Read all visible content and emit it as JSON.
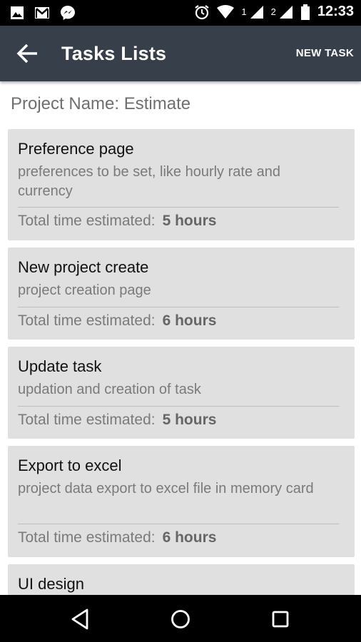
{
  "status_bar": {
    "time": "12:33",
    "sim1": "1",
    "sim2": "2",
    "icons_left": [
      "image-icon",
      "gmail-icon",
      "messenger-icon"
    ],
    "icons_right": [
      "alarm-icon",
      "wifi-icon",
      "signal-icon",
      "signal-icon",
      "battery-icon"
    ]
  },
  "app_bar": {
    "title": "Tasks Lists",
    "action": "NEW TASK",
    "background": "#37404a"
  },
  "project": {
    "label": "Project Name: Estimate"
  },
  "tasks": [
    {
      "title": "Preference page",
      "description": "preferences to be set, like hourly rate and currency",
      "time_label": "Total time estimated:",
      "time_value": "5 hours"
    },
    {
      "title": "New project create",
      "description": "project creation page",
      "time_label": "Total time estimated:",
      "time_value": "6 hours"
    },
    {
      "title": "Update task",
      "description": "updation and creation of task",
      "time_label": "Total time estimated:",
      "time_value": "5 hours"
    },
    {
      "title": "Export to excel",
      "description": "project data export to excel file in memory card",
      "time_label": "Total time estimated:",
      "time_value": "6 hours"
    },
    {
      "title": "UI design"
    }
  ],
  "nav_bar": {
    "buttons": [
      "back-icon",
      "home-icon",
      "recents-icon"
    ]
  }
}
